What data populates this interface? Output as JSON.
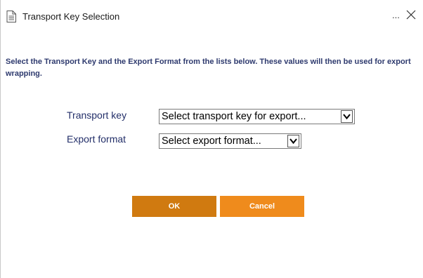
{
  "window": {
    "title": "Transport Key Selection",
    "more_label": "...",
    "icons": {
      "document": "document-icon",
      "close": "close-icon"
    }
  },
  "instructions": "Select the Transport Key and the Export Format from the lists below. These values will then be used for export wrapping.",
  "form": {
    "transport_key": {
      "label": "Transport key",
      "selected": "Select transport key for export..."
    },
    "export_format": {
      "label": "Export format",
      "selected": "Select export format..."
    }
  },
  "buttons": {
    "ok": "OK",
    "cancel": "Cancel"
  },
  "colors": {
    "label_text": "#232f69",
    "instructions_text": "#2e3a6e",
    "ok_button": "#d07a10",
    "cancel_button": "#ef8b1c"
  }
}
